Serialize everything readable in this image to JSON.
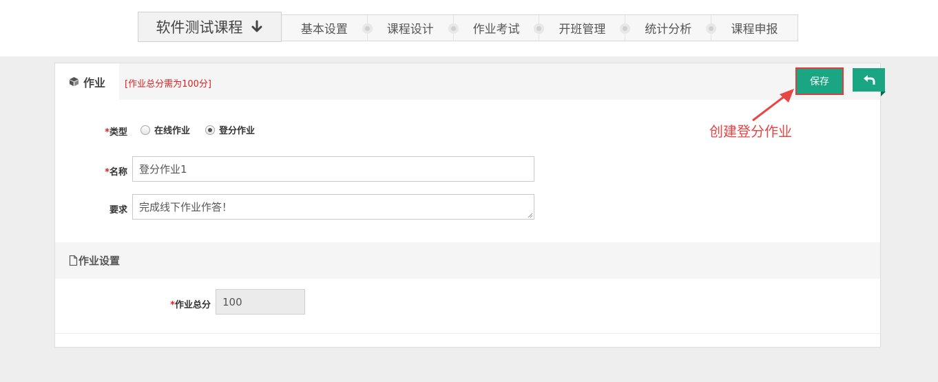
{
  "course": {
    "title": "软件测试课程",
    "icon": "arrow-down-icon"
  },
  "steps": [
    {
      "label": "基本设置"
    },
    {
      "label": "课程设计"
    },
    {
      "label": "作业考试"
    },
    {
      "label": "开班管理"
    },
    {
      "label": "统计分析"
    },
    {
      "label": "课程申报"
    }
  ],
  "panel": {
    "tab_label": "作业",
    "tab_icon": "cube-icon",
    "hint": "[作业总分需为100分]",
    "save_label": "保存",
    "back_icon": "reply-arrow-icon"
  },
  "form": {
    "type_label": "类型",
    "type_options": [
      {
        "label": "在线作业",
        "checked": false
      },
      {
        "label": "登分作业",
        "checked": true
      }
    ],
    "name_label": "名称",
    "name_value": "登分作业1",
    "requirement_label": "要求",
    "requirement_value": "完成线下作业作答！"
  },
  "settings": {
    "section_title": "作业设置",
    "section_icon": "document-icon",
    "total_label": "作业总分",
    "total_value": "100"
  },
  "annotation": {
    "text": "创建登分作业"
  },
  "colors": {
    "accent": "#1aa583",
    "required": "#e02020",
    "annotation": "#e84545"
  }
}
